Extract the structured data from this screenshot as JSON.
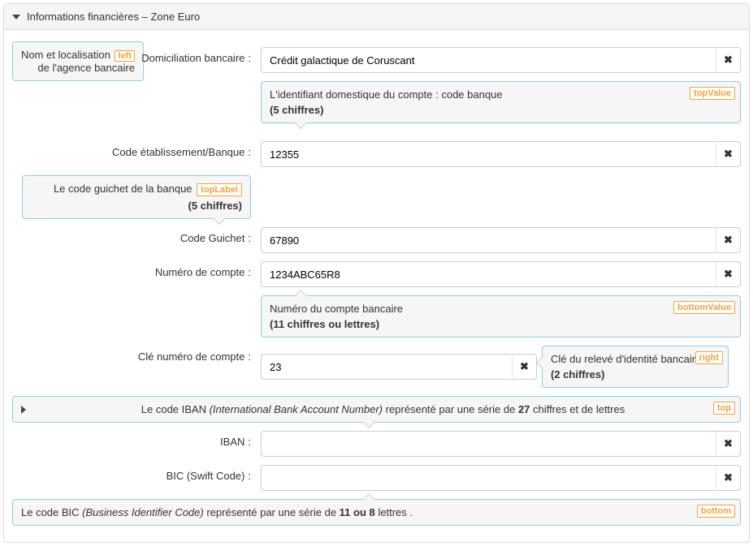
{
  "panel": {
    "title": "Informations financières – Zone Euro"
  },
  "badges": {
    "left": "left",
    "topValue": "topValue",
    "topLabel": "topLabel",
    "bottomValue": "bottomValue",
    "right": "right",
    "top": "top",
    "bottom": "bottom"
  },
  "fields": {
    "domiciliation": {
      "label": "Domiciliation bancaire",
      "value": "Crédit galactique de Coruscant",
      "leftTipLine1": "Nom et localisation",
      "leftTipLine2": "de l'agence bancaire"
    },
    "codeBanque": {
      "label": "Code établissement/Banque",
      "value": "12355",
      "tip": "L'identifiant domestique du compte : code banque",
      "tipSub": "(5 chiffres)"
    },
    "codeGuichet": {
      "label": "Code Guichet",
      "value": "67890",
      "tip": "Le code guichet de la banque",
      "tipSub": "(5 chiffres)"
    },
    "numeroCompte": {
      "label": "Numéro de compte",
      "value": "1234ABC65R8",
      "tip": "Numéro du compte bancaire",
      "tipSub": "(11 chiffres ou lettres)"
    },
    "cleCompte": {
      "label": "Clé numéro de compte",
      "value": "23",
      "tip": "Clé du relevé d'identité bancaire",
      "tipSub": "(2 chiffres)"
    },
    "iban": {
      "label": "IBAN",
      "value": "",
      "tipPrefix": "Le code IBAN ",
      "tipItalic": "(International Bank Account Number)",
      "tipMiddle": " représenté par une série de ",
      "tipBold": "27",
      "tipSuffix": " chiffres et de lettres"
    },
    "bic": {
      "label": "BIC (Swift Code)",
      "value": "",
      "tipPrefix": "Le code BIC ",
      "tipItalic": "(Business Identifier Code)",
      "tipMiddle": " représenté par une série de ",
      "tipBold": "11 ou 8",
      "tipSuffix": " lettres ."
    }
  }
}
